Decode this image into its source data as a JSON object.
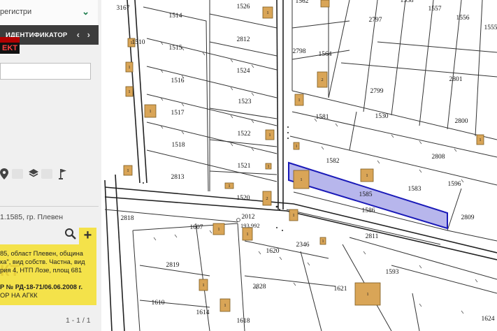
{
  "sidebar": {
    "registry_select": "регистри",
    "id_tab": "ИДЕНТИФИКАТОР",
    "nav_prev": "‹",
    "nav_next": "›",
    "logo_text": "EKT",
    "search_value": "",
    "parcel_ref": "1.1585, гр. Плевен",
    "info_lines": [
      "85, област Плевен, община",
      "ка\", вид собств. Частна, вид",
      "рия 4, НТП Лозе, площ 681",
      "Р № РД-18-71/06.06.2008 г.",
      "ОР НА АГКК"
    ],
    "info_ghost": "КТ",
    "pager": "1 - 1 / 1"
  },
  "map": {
    "highlight_parcel": "1585",
    "parcel_labels": [
      "1562",
      "1526",
      "2797",
      "1558",
      "1557",
      "1556",
      "1555",
      "3167",
      "1514",
      "2812",
      "2798",
      "1564",
      "1510",
      "1515",
      "1524",
      "2801",
      "1516",
      "1523",
      "2799",
      "1581",
      "1530",
      "1517",
      "2800",
      "1522",
      "1518",
      "2808",
      "1521",
      "1582",
      "1583",
      "1596",
      "2813",
      "1520",
      "1585",
      "2818",
      "1607",
      "2012",
      "1586",
      "2809",
      "2811",
      "2346",
      "1620",
      "2819",
      "1593",
      "2828",
      "1621",
      "1610",
      "1614",
      "1618",
      "1624"
    ],
    "height_label": "193.992",
    "building_labels": [
      "1",
      "1",
      "1",
      "2",
      "1",
      "1",
      "1",
      "1",
      "1",
      "1",
      "1",
      "1",
      "1",
      "1",
      "1",
      "2",
      "1",
      "1",
      "1",
      "1",
      "1",
      "1",
      "1",
      "1",
      "2",
      "1",
      "1",
      "1",
      "1",
      "1",
      "1",
      "1",
      "1",
      "1",
      "1"
    ],
    "colors": {
      "building_fill": "#d9a557",
      "highlight_fill": "#b7b6ec",
      "highlight_stroke": "#1a1ab8",
      "panel_yellow": "#f4e24a",
      "header_dark": "#3c3c3c"
    }
  }
}
